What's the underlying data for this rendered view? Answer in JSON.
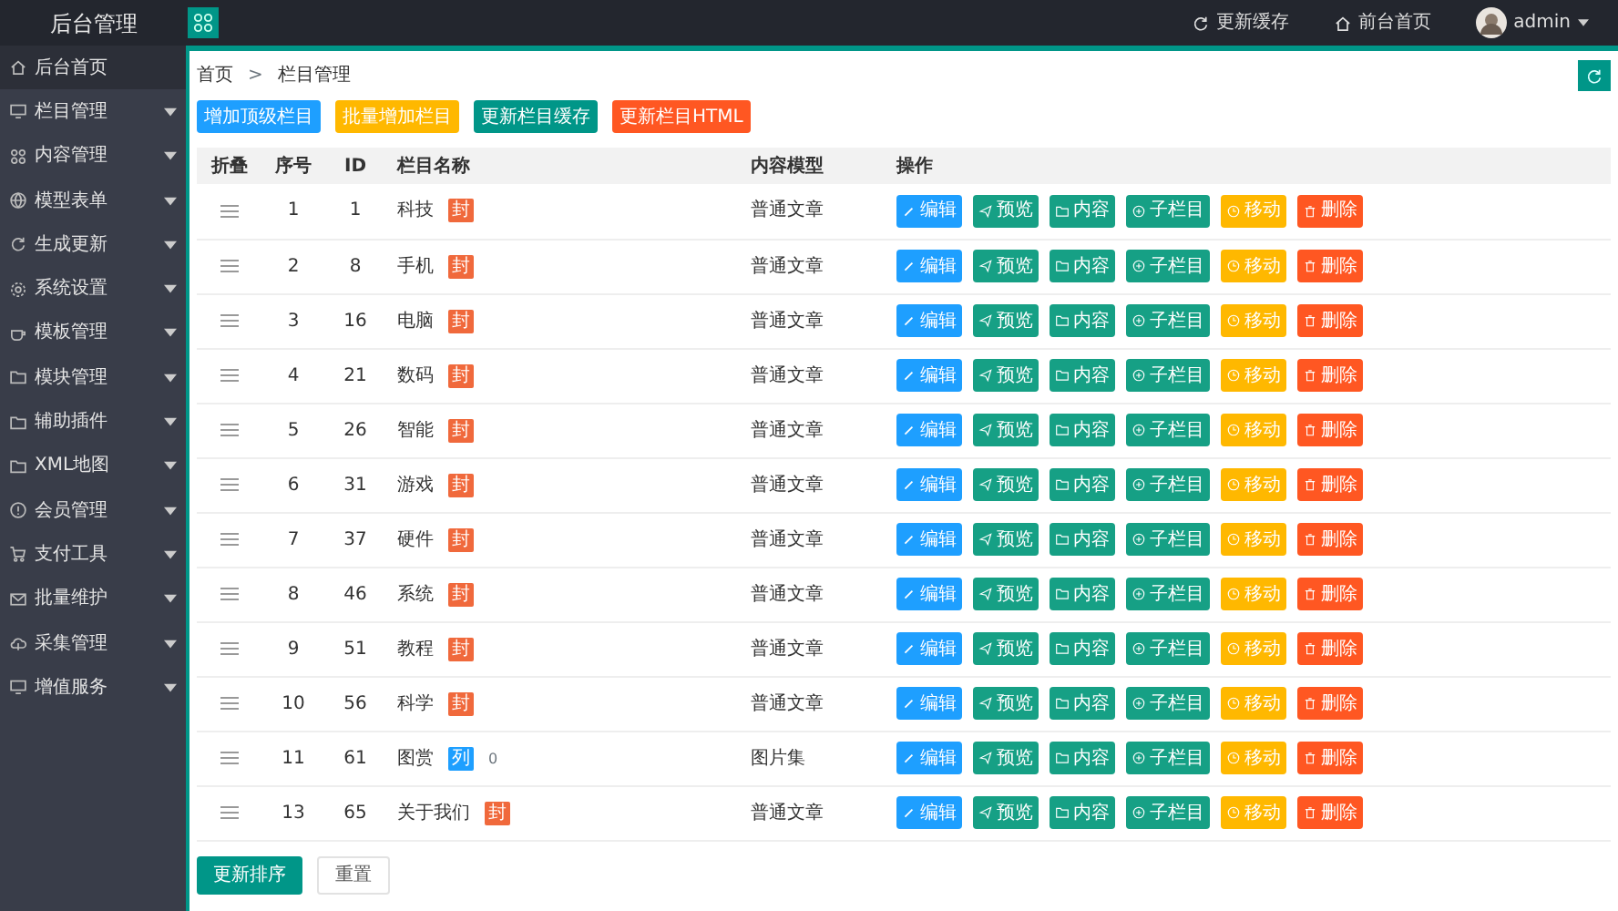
{
  "header": {
    "logo": "后台管理",
    "links": [
      {
        "label": "更新缓存",
        "kind": "refresh"
      },
      {
        "label": "前台首页",
        "kind": "home"
      }
    ],
    "user": "admin"
  },
  "sidebar": {
    "items": [
      {
        "label": "后台首页",
        "kind": "home",
        "expandable": false,
        "selected": true
      },
      {
        "label": "栏目管理",
        "kind": "monitor",
        "expandable": true,
        "selected": false
      },
      {
        "label": "内容管理",
        "kind": "grid",
        "expandable": true,
        "selected": false
      },
      {
        "label": "模型表单",
        "kind": "globe",
        "expandable": true,
        "selected": false
      },
      {
        "label": "生成更新",
        "kind": "refresh",
        "expandable": true,
        "selected": false
      },
      {
        "label": "系统设置",
        "kind": "gear",
        "expandable": true,
        "selected": false
      },
      {
        "label": "模板管理",
        "kind": "cup",
        "expandable": true,
        "selected": false
      },
      {
        "label": "模块管理",
        "kind": "folder",
        "expandable": true,
        "selected": false
      },
      {
        "label": "辅助插件",
        "kind": "folder",
        "expandable": true,
        "selected": false
      },
      {
        "label": "XML地图",
        "kind": "folder",
        "expandable": true,
        "selected": false
      },
      {
        "label": "会员管理",
        "kind": "info",
        "expandable": true,
        "selected": false
      },
      {
        "label": "支付工具",
        "kind": "cart",
        "expandable": true,
        "selected": false
      },
      {
        "label": "批量维护",
        "kind": "mail",
        "expandable": true,
        "selected": false
      },
      {
        "label": "采集管理",
        "kind": "cloud",
        "expandable": true,
        "selected": false
      },
      {
        "label": "增值服务",
        "kind": "monitor",
        "expandable": true,
        "selected": false
      }
    ]
  },
  "breadcrumb": {
    "items": [
      "首页",
      "栏目管理"
    ],
    "separator": ">"
  },
  "toolbar": [
    {
      "label": "增加顶级栏目",
      "kind": "info"
    },
    {
      "label": "批量增加栏目",
      "kind": "warning"
    },
    {
      "label": "更新栏目缓存",
      "kind": "primary"
    },
    {
      "label": "更新栏目HTML",
      "kind": "danger"
    }
  ],
  "table": {
    "columns": [
      "折叠",
      "序号",
      "ID",
      "栏目名称",
      "内容模型",
      "操作"
    ],
    "rows": [
      {
        "seq": "1",
        "id": "1",
        "name": "科技",
        "tag": {
          "label": "封",
          "kind": "single"
        },
        "model": "普通文章",
        "actions": [
          {
            "label": "编辑",
            "kind": "edit"
          },
          {
            "label": "预览",
            "kind": "preview"
          },
          {
            "label": "内容",
            "kind": "content"
          },
          {
            "label": "子栏目",
            "kind": "child"
          },
          {
            "label": "移动",
            "kind": "move"
          },
          {
            "label": "删除",
            "kind": "delete"
          }
        ]
      },
      {
        "seq": "2",
        "id": "8",
        "name": "手机",
        "tag": {
          "label": "封",
          "kind": "single"
        },
        "model": "普通文章",
        "actions": [
          {
            "label": "编辑",
            "kind": "edit"
          },
          {
            "label": "预览",
            "kind": "preview"
          },
          {
            "label": "内容",
            "kind": "content"
          },
          {
            "label": "子栏目",
            "kind": "child"
          },
          {
            "label": "移动",
            "kind": "move"
          },
          {
            "label": "删除",
            "kind": "delete"
          }
        ]
      },
      {
        "seq": "3",
        "id": "16",
        "name": "电脑",
        "tag": {
          "label": "封",
          "kind": "single"
        },
        "model": "普通文章",
        "actions": [
          {
            "label": "编辑",
            "kind": "edit"
          },
          {
            "label": "预览",
            "kind": "preview"
          },
          {
            "label": "内容",
            "kind": "content"
          },
          {
            "label": "子栏目",
            "kind": "child"
          },
          {
            "label": "移动",
            "kind": "move"
          },
          {
            "label": "删除",
            "kind": "delete"
          }
        ]
      },
      {
        "seq": "4",
        "id": "21",
        "name": "数码",
        "tag": {
          "label": "封",
          "kind": "single"
        },
        "model": "普通文章",
        "actions": [
          {
            "label": "编辑",
            "kind": "edit"
          },
          {
            "label": "预览",
            "kind": "preview"
          },
          {
            "label": "内容",
            "kind": "content"
          },
          {
            "label": "子栏目",
            "kind": "child"
          },
          {
            "label": "移动",
            "kind": "move"
          },
          {
            "label": "删除",
            "kind": "delete"
          }
        ]
      },
      {
        "seq": "5",
        "id": "26",
        "name": "智能",
        "tag": {
          "label": "封",
          "kind": "single"
        },
        "model": "普通文章",
        "actions": [
          {
            "label": "编辑",
            "kind": "edit"
          },
          {
            "label": "预览",
            "kind": "preview"
          },
          {
            "label": "内容",
            "kind": "content"
          },
          {
            "label": "子栏目",
            "kind": "child"
          },
          {
            "label": "移动",
            "kind": "move"
          },
          {
            "label": "删除",
            "kind": "delete"
          }
        ]
      },
      {
        "seq": "6",
        "id": "31",
        "name": "游戏",
        "tag": {
          "label": "封",
          "kind": "single"
        },
        "model": "普通文章",
        "actions": [
          {
            "label": "编辑",
            "kind": "edit"
          },
          {
            "label": "预览",
            "kind": "preview"
          },
          {
            "label": "内容",
            "kind": "content"
          },
          {
            "label": "子栏目",
            "kind": "child"
          },
          {
            "label": "移动",
            "kind": "move"
          },
          {
            "label": "删除",
            "kind": "delete"
          }
        ]
      },
      {
        "seq": "7",
        "id": "37",
        "name": "硬件",
        "tag": {
          "label": "封",
          "kind": "single"
        },
        "model": "普通文章",
        "actions": [
          {
            "label": "编辑",
            "kind": "edit"
          },
          {
            "label": "预览",
            "kind": "preview"
          },
          {
            "label": "内容",
            "kind": "content"
          },
          {
            "label": "子栏目",
            "kind": "child"
          },
          {
            "label": "移动",
            "kind": "move"
          },
          {
            "label": "删除",
            "kind": "delete"
          }
        ]
      },
      {
        "seq": "8",
        "id": "46",
        "name": "系统",
        "tag": {
          "label": "封",
          "kind": "single"
        },
        "model": "普通文章",
        "actions": [
          {
            "label": "编辑",
            "kind": "edit"
          },
          {
            "label": "预览",
            "kind": "preview"
          },
          {
            "label": "内容",
            "kind": "content"
          },
          {
            "label": "子栏目",
            "kind": "child"
          },
          {
            "label": "移动",
            "kind": "move"
          },
          {
            "label": "删除",
            "kind": "delete"
          }
        ]
      },
      {
        "seq": "9",
        "id": "51",
        "name": "教程",
        "tag": {
          "label": "封",
          "kind": "single"
        },
        "model": "普通文章",
        "actions": [
          {
            "label": "编辑",
            "kind": "edit"
          },
          {
            "label": "预览",
            "kind": "preview"
          },
          {
            "label": "内容",
            "kind": "content"
          },
          {
            "label": "子栏目",
            "kind": "child"
          },
          {
            "label": "移动",
            "kind": "move"
          },
          {
            "label": "删除",
            "kind": "delete"
          }
        ]
      },
      {
        "seq": "10",
        "id": "56",
        "name": "科学",
        "tag": {
          "label": "封",
          "kind": "single"
        },
        "model": "普通文章",
        "actions": [
          {
            "label": "编辑",
            "kind": "edit"
          },
          {
            "label": "预览",
            "kind": "preview"
          },
          {
            "label": "内容",
            "kind": "content"
          },
          {
            "label": "子栏目",
            "kind": "child"
          },
          {
            "label": "移动",
            "kind": "move"
          },
          {
            "label": "删除",
            "kind": "delete"
          }
        ]
      },
      {
        "seq": "11",
        "id": "61",
        "name": "图赏",
        "tag": {
          "label": "列",
          "kind": "list"
        },
        "count": "0",
        "model": "图片集",
        "actions": [
          {
            "label": "编辑",
            "kind": "edit"
          },
          {
            "label": "预览",
            "kind": "preview"
          },
          {
            "label": "内容",
            "kind": "content"
          },
          {
            "label": "子栏目",
            "kind": "child"
          },
          {
            "label": "移动",
            "kind": "move"
          },
          {
            "label": "删除",
            "kind": "delete"
          }
        ]
      },
      {
        "seq": "13",
        "id": "65",
        "name": "关于我们",
        "tag": {
          "label": "封",
          "kind": "single"
        },
        "model": "普通文章",
        "actions": [
          {
            "label": "编辑",
            "kind": "edit"
          },
          {
            "label": "预览",
            "kind": "preview"
          },
          {
            "label": "内容",
            "kind": "content"
          },
          {
            "label": "子栏目",
            "kind": "child"
          },
          {
            "label": "移动",
            "kind": "move"
          },
          {
            "label": "删除",
            "kind": "delete"
          }
        ]
      }
    ]
  },
  "footer_buttons": [
    {
      "label": "更新排序",
      "kind": "primary"
    },
    {
      "label": "重置",
      "kind": "plain"
    }
  ]
}
